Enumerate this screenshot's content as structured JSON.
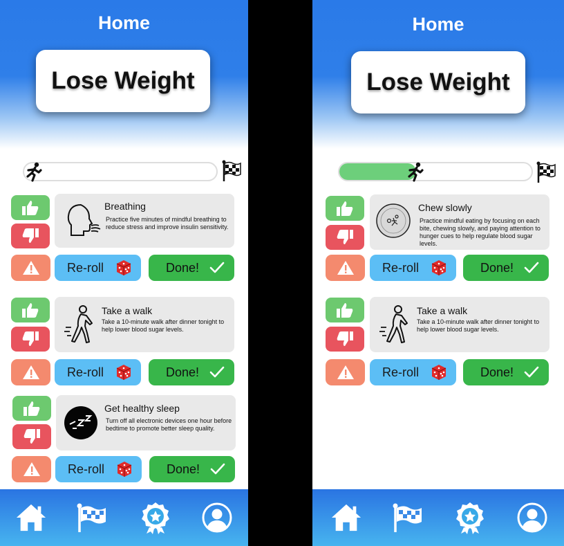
{
  "screens": [
    {
      "title": "Home",
      "goal": "Lose Weight",
      "progress": 0,
      "tasks": [
        {
          "icon": "breathing-icon",
          "title": "Breathing",
          "description": "Practice five minutes of mindful breathing to reduce stress and improve insulin sensitivity."
        },
        {
          "icon": "walking-person-icon",
          "title": "Take a walk",
          "description": "Take a 10-minute walk after dinner tonight to help lower blood sugar levels."
        },
        {
          "icon": "sleep-icon",
          "title": "Get healthy sleep",
          "description": "Turn off all electronic devices one hour before bedtime to promote better sleep quality."
        }
      ]
    },
    {
      "title": "Home",
      "goal": "Lose Weight",
      "progress": 0.4,
      "tasks": [
        {
          "icon": "chew-plate-icon",
          "title": "Chew slowly",
          "description": "Practice mindful eating by focusing on each bite, chewing slowly, and paying attention to hunger cues to help regulate blood sugar levels."
        },
        {
          "icon": "walking-person-icon",
          "title": "Take a walk",
          "description": "Take a 10-minute walk after dinner tonight to help lower blood sugar levels."
        }
      ]
    }
  ],
  "buttons": {
    "reroll": "Re-roll",
    "done": "Done!"
  },
  "nav": [
    {
      "icon": "home-icon"
    },
    {
      "icon": "goal-flag-icon"
    },
    {
      "icon": "achievement-badge-icon"
    },
    {
      "icon": "profile-icon"
    }
  ],
  "colors": {
    "primary": "#2a7ae8",
    "like": "#6dc96f",
    "dislike": "#e8545e",
    "report": "#f48a6e",
    "reroll": "#5cbef5",
    "done": "#38b64a",
    "progress": "#6dcf7b"
  }
}
